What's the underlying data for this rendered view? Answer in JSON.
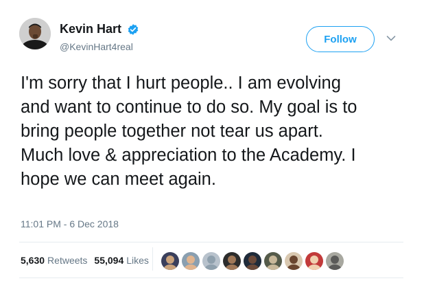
{
  "author": {
    "name": "Kevin Hart",
    "handle": "@KevinHart4real",
    "verified": true,
    "avatar_icon": "profile-photo"
  },
  "follow_button": {
    "label": "Follow"
  },
  "menu_icon": "chevron-down-icon",
  "tweet": {
    "lines": [
      "I'm sorry that I hurt people.. I am evolving",
      "and want to continue to do so. My goal is to",
      "bring people together not tear us apart.",
      "Much love & appreciation to the Academy.  I",
      "hope we can meet again."
    ],
    "timestamp": "11:01 PM - 6 Dec 2018"
  },
  "stats": {
    "retweets_count": "5,630",
    "retweets_label": "Retweets",
    "likes_count": "55,094",
    "likes_label": "Likes"
  },
  "likers": [
    {
      "name": "liker-avatar-1",
      "bg": "#3a3f5c",
      "fg": "#c9a27c"
    },
    {
      "name": "liker-avatar-2",
      "bg": "#8a9fb0",
      "fg": "#e0b48f"
    },
    {
      "name": "liker-avatar-3",
      "bg": "#b8c2cc",
      "fg": "#8fa0ad"
    },
    {
      "name": "liker-avatar-4",
      "bg": "#2c2c2c",
      "fg": "#a07858"
    },
    {
      "name": "liker-avatar-5",
      "bg": "#1f2b3a",
      "fg": "#6b4a3a"
    },
    {
      "name": "liker-avatar-6",
      "bg": "#555b4a",
      "fg": "#c8b89a"
    },
    {
      "name": "liker-avatar-7",
      "bg": "#d9c8b0",
      "fg": "#6a4630"
    },
    {
      "name": "liker-avatar-8",
      "bg": "#c23a3a",
      "fg": "#f0d0b0"
    },
    {
      "name": "liker-avatar-9",
      "bg": "#a8a8a0",
      "fg": "#5a5a58"
    }
  ],
  "colors": {
    "accent": "#1da1f2",
    "text": "#14171a",
    "secondary": "#657786",
    "divider": "#e6ecf0"
  }
}
